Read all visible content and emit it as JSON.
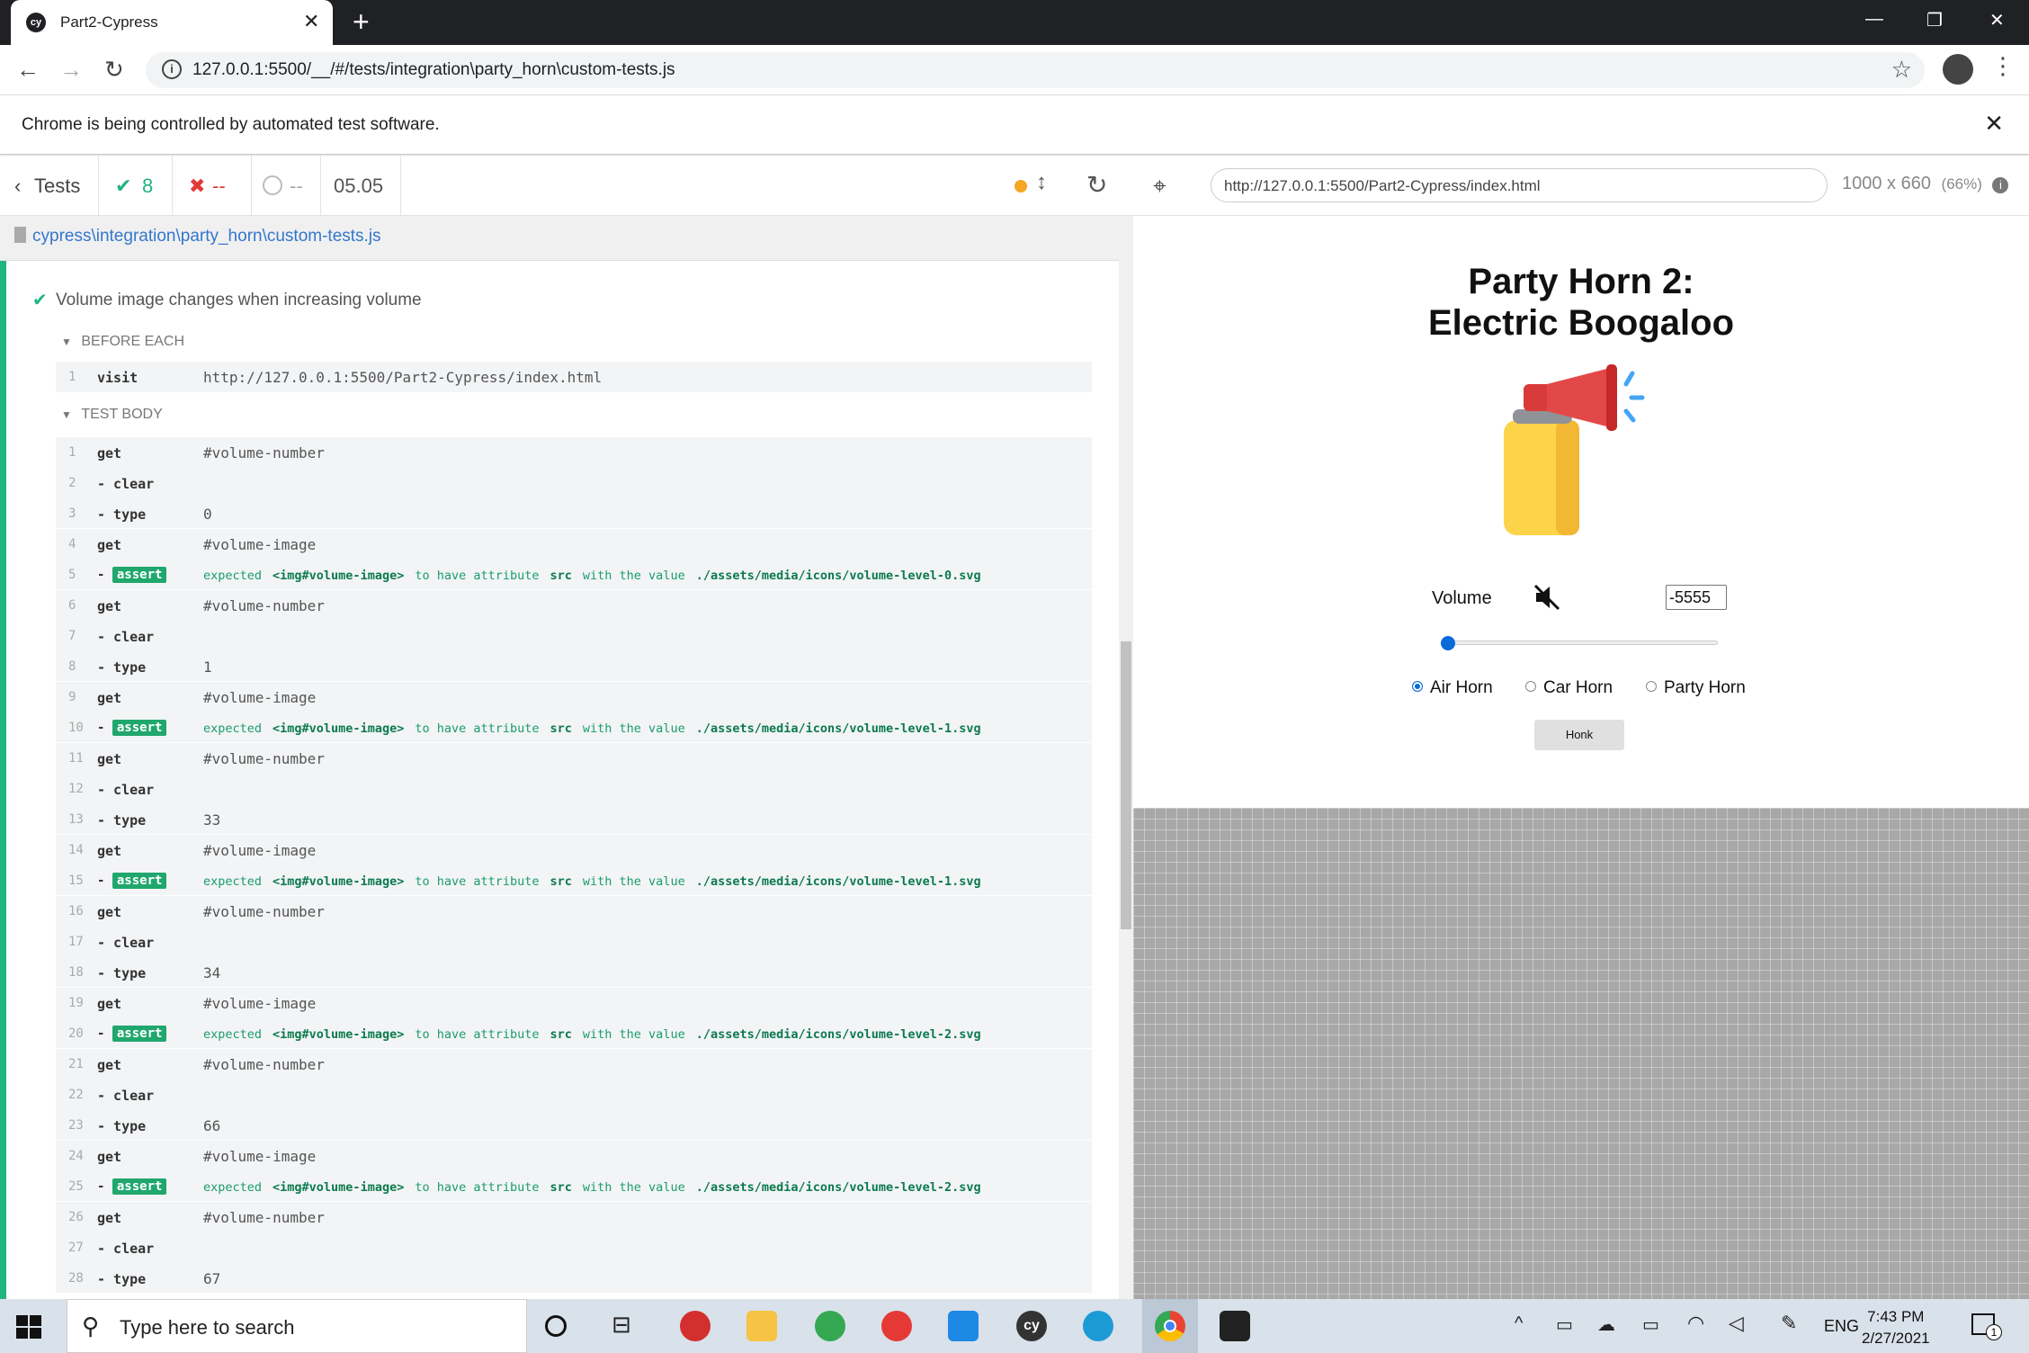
{
  "browser": {
    "tab_title": "Part2-Cypress",
    "tab_favicon": "cy",
    "address": "127.0.0.1:5500/__/#/tests/integration\\party_horn\\custom-tests.js",
    "automation_banner": "Chrome is being controlled by automated test software."
  },
  "reporter": {
    "back_label": "Tests",
    "passed": "8",
    "failed": "--",
    "pending": "--",
    "duration": "05.05",
    "spec_path": "cypress\\integration\\party_horn\\custom-tests.js",
    "test_title": "Volume image changes when increasing volume",
    "before_each_label": "BEFORE EACH",
    "test_body_label": "TEST BODY",
    "before_each": [
      {
        "n": "1",
        "cmd": "visit",
        "arg": "http://127.0.0.1:5500/Part2-Cypress/index.html"
      }
    ],
    "commands": [
      {
        "n": "1",
        "cmd": "get",
        "arg": "#volume-number"
      },
      {
        "n": "2",
        "cmd": "- clear",
        "arg": ""
      },
      {
        "n": "3",
        "cmd": "- type",
        "arg": "0"
      },
      {
        "n": "4",
        "cmd": "get",
        "arg": "#volume-image"
      },
      {
        "n": "5",
        "cmd": "assert",
        "arg": "expected <img#volume-image> to have attribute src with the value ./assets/media/icons/volume-level-0.svg"
      },
      {
        "n": "6",
        "cmd": "get",
        "arg": "#volume-number"
      },
      {
        "n": "7",
        "cmd": "- clear",
        "arg": ""
      },
      {
        "n": "8",
        "cmd": "- type",
        "arg": "1"
      },
      {
        "n": "9",
        "cmd": "get",
        "arg": "#volume-image"
      },
      {
        "n": "10",
        "cmd": "assert",
        "arg": "expected <img#volume-image> to have attribute src with the value ./assets/media/icons/volume-level-1.svg"
      },
      {
        "n": "11",
        "cmd": "get",
        "arg": "#volume-number"
      },
      {
        "n": "12",
        "cmd": "- clear",
        "arg": ""
      },
      {
        "n": "13",
        "cmd": "- type",
        "arg": "33"
      },
      {
        "n": "14",
        "cmd": "get",
        "arg": "#volume-image"
      },
      {
        "n": "15",
        "cmd": "assert",
        "arg": "expected <img#volume-image> to have attribute src with the value ./assets/media/icons/volume-level-1.svg"
      },
      {
        "n": "16",
        "cmd": "get",
        "arg": "#volume-number"
      },
      {
        "n": "17",
        "cmd": "- clear",
        "arg": ""
      },
      {
        "n": "18",
        "cmd": "- type",
        "arg": "34"
      },
      {
        "n": "19",
        "cmd": "get",
        "arg": "#volume-image"
      },
      {
        "n": "20",
        "cmd": "assert",
        "arg": "expected <img#volume-image> to have attribute src with the value ./assets/media/icons/volume-level-2.svg"
      },
      {
        "n": "21",
        "cmd": "get",
        "arg": "#volume-number"
      },
      {
        "n": "22",
        "cmd": "- clear",
        "arg": ""
      },
      {
        "n": "23",
        "cmd": "- type",
        "arg": "66"
      },
      {
        "n": "24",
        "cmd": "get",
        "arg": "#volume-image"
      },
      {
        "n": "25",
        "cmd": "assert",
        "arg": "expected <img#volume-image> to have attribute src with the value ./assets/media/icons/volume-level-2.svg"
      },
      {
        "n": "26",
        "cmd": "get",
        "arg": "#volume-number"
      },
      {
        "n": "27",
        "cmd": "- clear",
        "arg": ""
      },
      {
        "n": "28",
        "cmd": "- type",
        "arg": "67"
      }
    ]
  },
  "aut": {
    "url": "http://127.0.0.1:5500/Part2-Cypress/index.html",
    "dims": "1000 x 660",
    "scale": "(66%)",
    "title_line1": "Party Horn 2:",
    "title_line2": "Electric Boogaloo",
    "volume_label": "Volume",
    "volume_value": "-5555",
    "slider_level": 0,
    "horn_options": [
      "Air Horn",
      "Car Horn",
      "Party Horn"
    ],
    "selected_horn": "Air Horn",
    "honk_label": "Honk"
  },
  "taskbar": {
    "search_placeholder": "Type here to search",
    "language": "ENG",
    "time": "7:43 PM",
    "date": "2/27/2021",
    "notifications": "1"
  },
  "colors": {
    "pass": "#1fb57f",
    "fail": "#e53935",
    "link": "#3377cc",
    "pending_dot": "#f5a623"
  }
}
